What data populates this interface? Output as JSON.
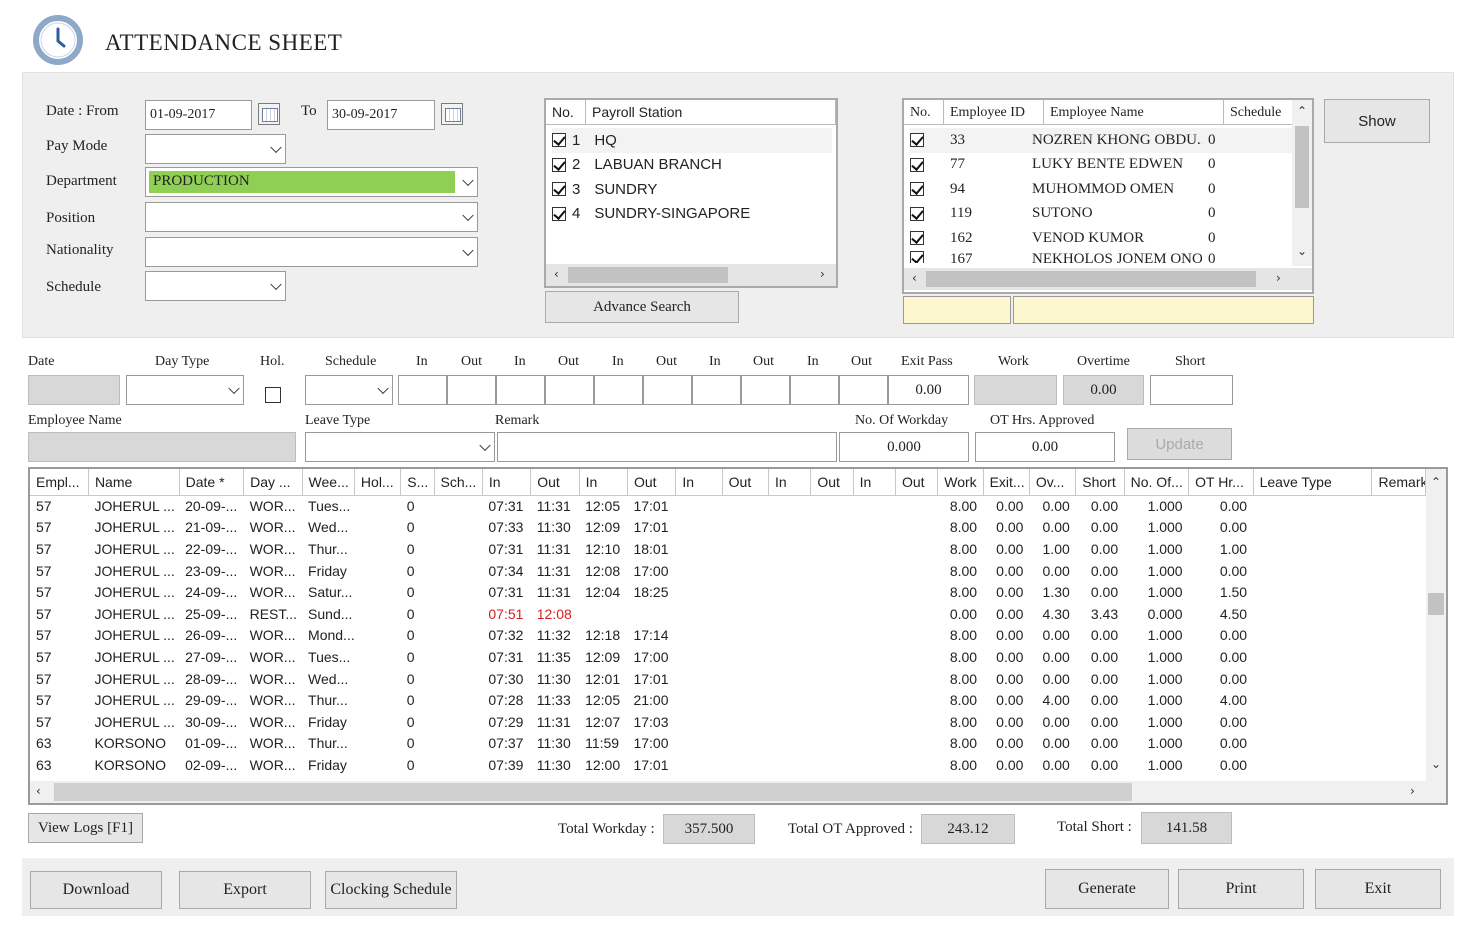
{
  "app": {
    "title": "ATTENDANCE SHEET",
    "icon": "clock-icon"
  },
  "filters": {
    "date_from_label": "Date : From",
    "date_from": "01-09-2017",
    "to_label": "To",
    "date_to": "30-09-2017",
    "pay_mode_label": "Pay Mode",
    "pay_mode": "",
    "department_label": "Department",
    "department": "PRODUCTION",
    "position_label": "Position",
    "position": "",
    "nationality_label": "Nationality",
    "nationality": "",
    "schedule_label": "Schedule",
    "schedule": ""
  },
  "payroll": {
    "headers": [
      "No.",
      "Payroll Station"
    ],
    "items": [
      {
        "no": "1",
        "name": "HQ",
        "checked": true
      },
      {
        "no": "2",
        "name": "LABUAN BRANCH",
        "checked": true
      },
      {
        "no": "3",
        "name": "SUNDRY",
        "checked": true
      },
      {
        "no": "4",
        "name": "SUNDRY-SINGAPORE",
        "checked": true
      }
    ],
    "advance_search": "Advance Search"
  },
  "employees": {
    "headers": [
      "No.",
      "Employee ID",
      "Employee Name",
      "Schedule"
    ],
    "items": [
      {
        "id": "33",
        "name": "NOZREN KHONG OBDU...",
        "schedule": "0"
      },
      {
        "id": "77",
        "name": "LUKY BENTE EDWEN",
        "schedule": "0"
      },
      {
        "id": "94",
        "name": "MUHOMMOD OMEN",
        "schedule": "0"
      },
      {
        "id": "119",
        "name": "SUTONO",
        "schedule": "0"
      },
      {
        "id": "162",
        "name": "VENOD KUMOR",
        "schedule": "0"
      },
      {
        "id": "167",
        "name": "NEKHOLOS JONEM ONO",
        "schedule": "0"
      }
    ],
    "show_button": "Show"
  },
  "editor": {
    "labels": {
      "date": "Date",
      "day_type": "Day Type",
      "hol": "Hol.",
      "schedule": "Schedule",
      "in": "In",
      "out": "Out",
      "exit_pass": "Exit Pass",
      "work": "Work",
      "overtime": "Overtime",
      "short": "Short",
      "employee_name": "Employee Name",
      "leave_type": "Leave Type",
      "remark": "Remark",
      "no_of_workday": "No. Of Workday",
      "ot_hrs_approved": "OT Hrs. Approved"
    },
    "exit_pass": "0.00",
    "overtime": "0.00",
    "no_of_workday": "0.000",
    "ot_hrs_approved": "0.00",
    "update_button": "Update"
  },
  "grid": {
    "headers": [
      "Empl...",
      "Name",
      "Date *",
      "Day ...",
      "Wee...",
      "Hol...",
      "S...",
      "Sch...",
      "In",
      "Out",
      "In",
      "Out",
      "In",
      "Out",
      "In",
      "Out",
      "In",
      "Out",
      "Work",
      "Exit...",
      "Ov...",
      "Short",
      "No. Of...",
      "OT Hr...",
      "Leave Type",
      "Remark"
    ],
    "rows": [
      [
        "57",
        "JOHERUL ...",
        "20-09-...",
        "WOR...",
        "Tues...",
        "",
        "0",
        "",
        "07:31",
        "11:31",
        "12:05",
        "17:01",
        "",
        "",
        "",
        "",
        "",
        "",
        "8.00",
        "0.00",
        "0.00",
        "0.00",
        "1.000",
        "0.00",
        "",
        ""
      ],
      [
        "57",
        "JOHERUL ...",
        "21-09-...",
        "WOR...",
        "Wed...",
        "",
        "0",
        "",
        "07:33",
        "11:30",
        "12:09",
        "17:01",
        "",
        "",
        "",
        "",
        "",
        "",
        "8.00",
        "0.00",
        "0.00",
        "0.00",
        "1.000",
        "0.00",
        "",
        ""
      ],
      [
        "57",
        "JOHERUL ...",
        "22-09-...",
        "WOR...",
        "Thur...",
        "",
        "0",
        "",
        "07:31",
        "11:31",
        "12:10",
        "18:01",
        "",
        "",
        "",
        "",
        "",
        "",
        "8.00",
        "0.00",
        "1.00",
        "0.00",
        "1.000",
        "1.00",
        "",
        ""
      ],
      [
        "57",
        "JOHERUL ...",
        "23-09-...",
        "WOR...",
        "Friday",
        "",
        "0",
        "",
        "07:34",
        "11:31",
        "12:08",
        "17:00",
        "",
        "",
        "",
        "",
        "",
        "",
        "8.00",
        "0.00",
        "0.00",
        "0.00",
        "1.000",
        "0.00",
        "",
        ""
      ],
      [
        "57",
        "JOHERUL ...",
        "24-09-...",
        "WOR...",
        "Satur...",
        "",
        "0",
        "",
        "07:31",
        "11:31",
        "12:04",
        "18:25",
        "",
        "",
        "",
        "",
        "",
        "",
        "8.00",
        "0.00",
        "1.30",
        "0.00",
        "1.000",
        "1.50",
        "",
        ""
      ],
      [
        "57",
        "JOHERUL ...",
        "25-09-...",
        "REST...",
        "Sund...",
        "",
        "0",
        "",
        "07:51",
        "12:08",
        "",
        "",
        "",
        "",
        "",
        "",
        "",
        "",
        "0.00",
        "0.00",
        "4.30",
        "3.43",
        "0.000",
        "4.50",
        "",
        ""
      ],
      [
        "57",
        "JOHERUL ...",
        "26-09-...",
        "WOR...",
        "Mond...",
        "",
        "0",
        "",
        "07:32",
        "11:32",
        "12:18",
        "17:14",
        "",
        "",
        "",
        "",
        "",
        "",
        "8.00",
        "0.00",
        "0.00",
        "0.00",
        "1.000",
        "0.00",
        "",
        ""
      ],
      [
        "57",
        "JOHERUL ...",
        "27-09-...",
        "WOR...",
        "Tues...",
        "",
        "0",
        "",
        "07:31",
        "11:35",
        "12:09",
        "17:00",
        "",
        "",
        "",
        "",
        "",
        "",
        "8.00",
        "0.00",
        "0.00",
        "0.00",
        "1.000",
        "0.00",
        "",
        ""
      ],
      [
        "57",
        "JOHERUL ...",
        "28-09-...",
        "WOR...",
        "Wed...",
        "",
        "0",
        "",
        "07:30",
        "11:30",
        "12:01",
        "17:01",
        "",
        "",
        "",
        "",
        "",
        "",
        "8.00",
        "0.00",
        "0.00",
        "0.00",
        "1.000",
        "0.00",
        "",
        ""
      ],
      [
        "57",
        "JOHERUL ...",
        "29-09-...",
        "WOR...",
        "Thur...",
        "",
        "0",
        "",
        "07:28",
        "11:33",
        "12:05",
        "21:00",
        "",
        "",
        "",
        "",
        "",
        "",
        "8.00",
        "0.00",
        "4.00",
        "0.00",
        "1.000",
        "4.00",
        "",
        ""
      ],
      [
        "57",
        "JOHERUL ...",
        "30-09-...",
        "WOR...",
        "Friday",
        "",
        "0",
        "",
        "07:29",
        "11:31",
        "12:07",
        "17:03",
        "",
        "",
        "",
        "",
        "",
        "",
        "8.00",
        "0.00",
        "0.00",
        "0.00",
        "1.000",
        "0.00",
        "",
        ""
      ],
      [
        "63",
        "KORSONO",
        "01-09-...",
        "WOR...",
        "Thur...",
        "",
        "0",
        "",
        "07:37",
        "11:30",
        "11:59",
        "17:00",
        "",
        "",
        "",
        "",
        "",
        "",
        "8.00",
        "0.00",
        "0.00",
        "0.00",
        "1.000",
        "0.00",
        "",
        ""
      ],
      [
        "63",
        "KORSONO",
        "02-09-...",
        "WOR...",
        "Friday",
        "",
        "0",
        "",
        "07:39",
        "11:30",
        "12:00",
        "17:01",
        "",
        "",
        "",
        "",
        "",
        "",
        "8.00",
        "0.00",
        "0.00",
        "0.00",
        "1.000",
        "0.00",
        "",
        ""
      ]
    ],
    "highlight_row": 5,
    "highlight_color": "#d62020"
  },
  "totals": {
    "view_logs": "View Logs [F1]",
    "total_workday_label": "Total Workday :",
    "total_workday": "357.500",
    "total_ot_label": "Total OT Approved :",
    "total_ot": "243.12",
    "total_short_label": "Total Short :",
    "total_short": "141.58"
  },
  "actions": {
    "download": "Download",
    "export": "Export",
    "clocking_schedule": "Clocking Schedule",
    "generate": "Generate",
    "print": "Print",
    "exit": "Exit"
  },
  "colors": {
    "department_fill": "#8fcf54",
    "panel_bg": "#efefef",
    "accent_icon": "#5b84b8"
  }
}
